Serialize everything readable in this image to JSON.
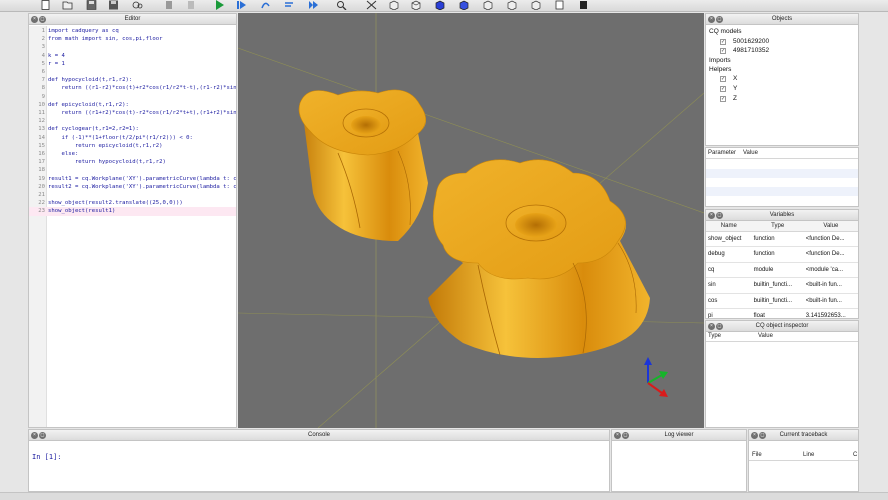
{
  "toolbar": {
    "icons": [
      "new-file-icon",
      "open-file-icon",
      "save-icon",
      "save-as-icon",
      "examples-icon",
      "undo-icon",
      "redo-icon",
      "run-icon",
      "debug-icon",
      "step-over-icon",
      "step-in-icon",
      "continue-icon",
      "inspect-icon",
      "fit-icon",
      "iso-view-icon",
      "top-view-icon",
      "bottom-view-icon",
      "front-view-icon",
      "back-view-icon",
      "left-view-icon",
      "right-view-icon",
      "wireframe-icon",
      "shaded-icon"
    ]
  },
  "editor": {
    "title": "Editor",
    "lines": [
      {
        "n": "1",
        "text": "import cadquery as cq"
      },
      {
        "n": "2",
        "text": "from math import sin, cos,pi,floor"
      },
      {
        "n": "3",
        "text": ""
      },
      {
        "n": "4",
        "text": "k = 4"
      },
      {
        "n": "5",
        "text": "r = 1"
      },
      {
        "n": "6",
        "text": ""
      },
      {
        "n": "7",
        "text": "def hypocycloid(t,r1,r2):"
      },
      {
        "n": "8",
        "text": "    return ((r1-r2)*cos(t)+r2*cos(r1/r2*t-t),(r1-r2)*sin(t)+r2*sin(-"
      },
      {
        "n": "9",
        "text": ""
      },
      {
        "n": "10",
        "text": "def epicycloid(t,r1,r2):"
      },
      {
        "n": "11",
        "text": "    return ((r1+r2)*cos(t)-r2*cos(r1/r2*t+t),(r1+r2)*sin(t)-r2*sin(r"
      },
      {
        "n": "12",
        "text": ""
      },
      {
        "n": "13",
        "text": "def cyclogear(t,r1=2,r2=1):"
      },
      {
        "n": "14",
        "text": "    if (-1)**(1+floor(t/2/pi*(r1/r2))) < 0:"
      },
      {
        "n": "15",
        "text": "        return epicycloid(t,r1,r2)"
      },
      {
        "n": "16",
        "text": "    else:"
      },
      {
        "n": "17",
        "text": "        return hypocycloid(t,r1,r2)"
      },
      {
        "n": "18",
        "text": ""
      },
      {
        "n": "19",
        "text": "result1 = cq.Workplane('XY').parametricCurve(lambda t: cyclog"
      },
      {
        "n": "20",
        "text": "result2 = cq.Workplane('XY').parametricCurve(lambda t: cyclog"
      },
      {
        "n": "21",
        "text": ""
      },
      {
        "n": "22",
        "text": "show_object(result2.translate((25,0,0)))"
      },
      {
        "n": "23",
        "text": "show_object(result1)"
      }
    ]
  },
  "objects": {
    "title": "Objects",
    "cq_models_label": "CQ models",
    "models": [
      "5001629200",
      "4981710352"
    ],
    "imports_label": "Imports",
    "helpers_label": "Helpers",
    "helpers": [
      "X",
      "Y",
      "Z"
    ]
  },
  "parameters": {
    "col_parameter": "Parameter",
    "col_value": "Value"
  },
  "variables": {
    "title": "Variables",
    "columns": [
      "Name",
      "Type",
      "Value"
    ],
    "rows": [
      [
        "show_object",
        "function",
        "<function De..."
      ],
      [
        "debug",
        "function",
        "<function De..."
      ],
      [
        "cq",
        "module",
        "<module 'ca..."
      ],
      [
        "sin",
        "builtin_functi...",
        "<built-in fun..."
      ],
      [
        "cos",
        "builtin_functi...",
        "<built-in fun..."
      ],
      [
        "pi",
        "float",
        "3.141592653..."
      ]
    ]
  },
  "inspector": {
    "title": "CQ object inspector",
    "col_type": "Type",
    "col_value": "Value"
  },
  "console": {
    "title": "Console",
    "prompt": "In [1]:"
  },
  "log": {
    "title": "Log viewer"
  },
  "traceback": {
    "title": "Current traceback",
    "columns": [
      "File",
      "Line",
      "C"
    ]
  },
  "colors": {
    "gear": "#e8a317",
    "viewport": "#6e6e6e"
  }
}
